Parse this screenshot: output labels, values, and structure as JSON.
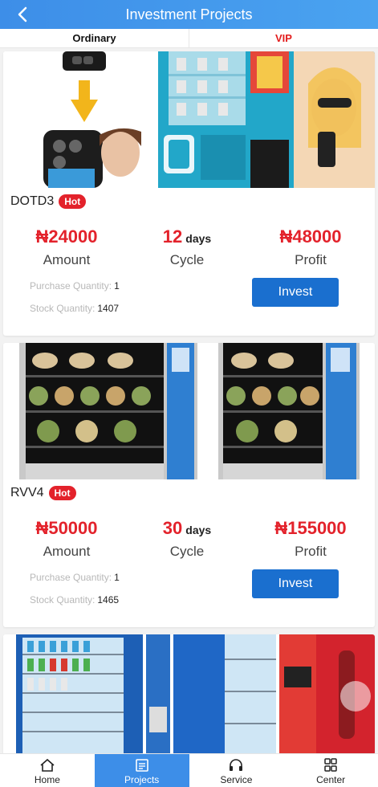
{
  "header": {
    "title": "Investment Projects"
  },
  "tabs": {
    "ordinary": "Ordinary",
    "vip": "VIP"
  },
  "projects": [
    {
      "name": "DOTD3",
      "badge": "Hot",
      "amount": "₦24000",
      "amount_label": "Amount",
      "cycle": "12",
      "cycle_unit": "days",
      "cycle_label": "Cycle",
      "profit": "₦48000",
      "profit_label": "Profit",
      "purchase_label": "Purchase Quantity:",
      "purchase_qty": "1",
      "stock_label": "Stock Quantity:",
      "stock_qty": "1407",
      "invest_label": "Invest"
    },
    {
      "name": "RVV4",
      "badge": "Hot",
      "amount": "₦50000",
      "amount_label": "Amount",
      "cycle": "30",
      "cycle_unit": "days",
      "cycle_label": "Cycle",
      "profit": "₦155000",
      "profit_label": "Profit",
      "purchase_label": "Purchase Quantity:",
      "purchase_qty": "1",
      "stock_label": "Stock Quantity:",
      "stock_qty": "1465",
      "invest_label": "Invest"
    }
  ],
  "nav": {
    "home": "Home",
    "projects": "Projects",
    "service": "Service",
    "center": "Center"
  },
  "colors": {
    "accent": "#3d8ee8",
    "price": "#e3222b",
    "button": "#1a6fcf"
  }
}
